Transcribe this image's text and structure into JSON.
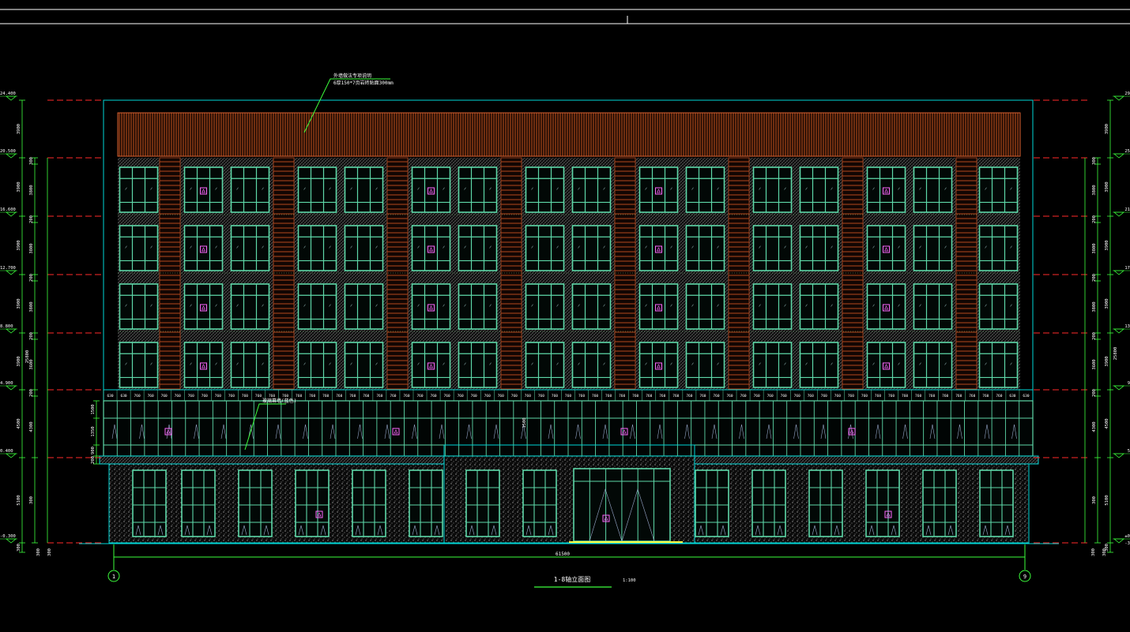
{
  "drawing": {
    "title": "1-8轴立面图",
    "scale": "1:100",
    "note_line1": "外墙做法专项说明",
    "note_line2": "6厚150*7页岩砖贴面300mm",
    "podium_label": "玻璃幕墙(蓝色)",
    "total_width": "61500",
    "total_height": "25800",
    "axis_start": "1",
    "axis_end": "9",
    "elevations_left": [
      "24.400",
      "20.500",
      "16.600",
      "12.700",
      "8.800",
      "4.900",
      "0.400",
      "-0.300"
    ],
    "elevations_right": [
      "29",
      "25",
      "21",
      "17",
      "13",
      "9",
      "5",
      "±0",
      "-3"
    ],
    "dims_left_col1": [
      "3900",
      "3900",
      "3900",
      "3900",
      "3900",
      "4500",
      "5100",
      "300"
    ],
    "dims_left_col2": [
      "300",
      "3800",
      "200",
      "3800",
      "200",
      "3800",
      "200",
      "3600",
      "200",
      "4300",
      "300"
    ],
    "dims_podium": [
      "1500",
      "1350",
      "900",
      "200"
    ],
    "bay_dims": [
      "630",
      "630",
      "760",
      "760",
      "760",
      "760",
      "760",
      "760",
      "760",
      "760",
      "760",
      "760",
      "760",
      "760",
      "760",
      "760",
      "760",
      "760",
      "760",
      "760",
      "760",
      "760",
      "760",
      "760",
      "760",
      "760",
      "760",
      "760",
      "760",
      "760",
      "760",
      "760",
      "760",
      "760",
      "760",
      "760",
      "760",
      "760",
      "760",
      "760",
      "760",
      "760",
      "760",
      "760",
      "760",
      "760",
      "760",
      "760",
      "760",
      "760",
      "760",
      "760",
      "760",
      "760",
      "760",
      "760",
      "760",
      "760",
      "760",
      "760",
      "760",
      "760",
      "760",
      "760",
      "760",
      "760",
      "760",
      "630",
      "630"
    ]
  },
  "colors": {
    "background": "#000000",
    "frame": "#ffffff",
    "outline": "#00d8d8",
    "window": "#5ed8a8",
    "roof_band": "#c8551e",
    "pier": "#b4481e",
    "dim_line": "#3cff3c",
    "level_line": "#ff2a2a",
    "marker": "#ff66ff",
    "hatch": "#8a8a8a"
  },
  "icons": [
    "elevation-marker-icon",
    "axis-bubble-icon"
  ]
}
